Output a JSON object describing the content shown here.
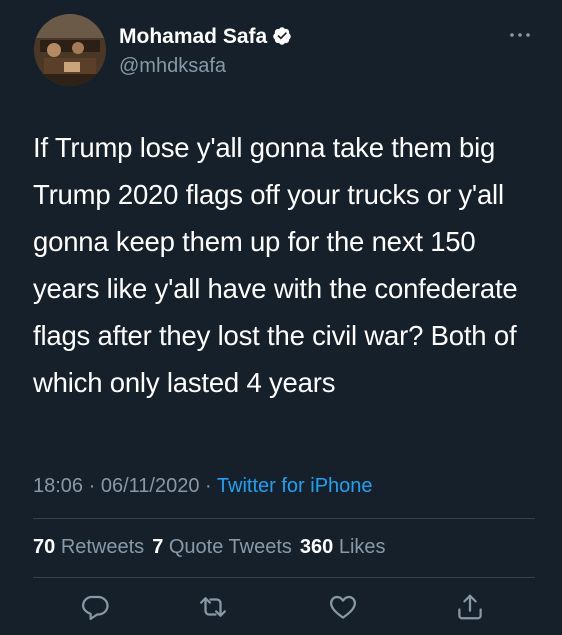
{
  "author": {
    "display_name": "Mohamad Safa",
    "handle": "@mhdksafa",
    "verified_icon": "verified-badge-icon",
    "avatar_icon": "profile-photo"
  },
  "tweet": {
    "text": "If Trump lose y'all gonna take them big Trump 2020 flags off your trucks or y'all gonna keep them up for the next 150 years like y'all have with the confederate flags after they lost the civil war? Both of which only lasted 4 years",
    "time": "18:06",
    "separator": "·",
    "date": "06/11/2020",
    "source": "Twitter for iPhone"
  },
  "stats": {
    "retweets_count": "70",
    "retweets_label": "Retweets",
    "quote_count": "7",
    "quote_label": "Quote Tweets",
    "likes_count": "360",
    "likes_label": "Likes"
  },
  "actions": [
    "reply-icon",
    "retweet-icon",
    "like-icon",
    "share-icon"
  ],
  "colors": {
    "background": "#15202b",
    "primary_text": "#ffffff",
    "secondary_text": "#8899a6",
    "link": "#1da1f2",
    "divider": "#38444d"
  }
}
